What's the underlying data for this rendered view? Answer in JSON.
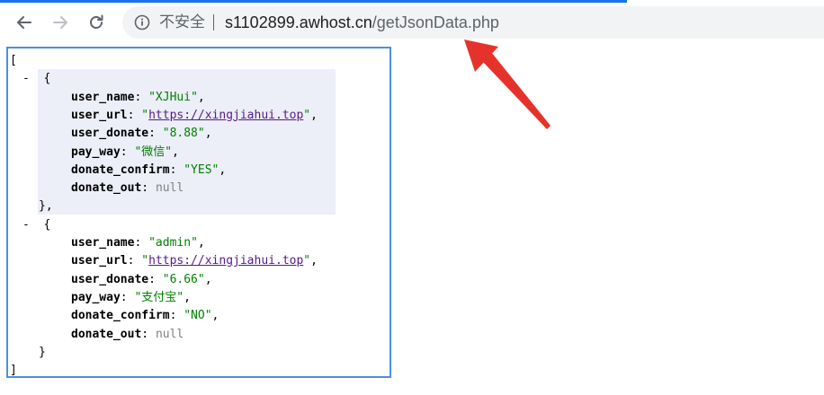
{
  "browser": {
    "security_label": "不安全",
    "url_host": "s1102899.awhost.cn",
    "url_path": "/getJsonData.php"
  },
  "json": {
    "open_bracket": "[",
    "close_bracket": "]",
    "toggle": "-",
    "open_brace": "{",
    "close_brace_comma": "},",
    "close_brace": "}",
    "items": [
      {
        "fields": [
          {
            "key": "user_name",
            "value": "\"XJHui\"",
            "type": "string",
            "comma": ","
          },
          {
            "key": "user_url",
            "value": "https://xingjiahui.top",
            "type": "link",
            "comma": ","
          },
          {
            "key": "user_donate",
            "value": "\"8.88\"",
            "type": "string",
            "comma": ","
          },
          {
            "key": "pay_way",
            "value": "\"微信\"",
            "type": "string",
            "comma": ","
          },
          {
            "key": "donate_confirm",
            "value": "\"YES\"",
            "type": "string",
            "comma": ","
          },
          {
            "key": "donate_out",
            "value": "null",
            "type": "null",
            "comma": ""
          }
        ]
      },
      {
        "fields": [
          {
            "key": "user_name",
            "value": "\"admin\"",
            "type": "string",
            "comma": ","
          },
          {
            "key": "user_url",
            "value": "https://xingjiahui.top",
            "type": "link",
            "comma": ","
          },
          {
            "key": "user_donate",
            "value": "\"6.66\"",
            "type": "string",
            "comma": ","
          },
          {
            "key": "pay_way",
            "value": "\"支付宝\"",
            "type": "string",
            "comma": ","
          },
          {
            "key": "donate_confirm",
            "value": "\"NO\"",
            "type": "string",
            "comma": ","
          },
          {
            "key": "donate_out",
            "value": "null",
            "type": "null",
            "comma": ""
          }
        ]
      }
    ]
  },
  "colors": {
    "string": "#008000",
    "link": "#551a8b",
    "null": "#808080",
    "highlight": "#eceef8",
    "box_border": "#4a90d9",
    "arrow": "#e5332b"
  }
}
